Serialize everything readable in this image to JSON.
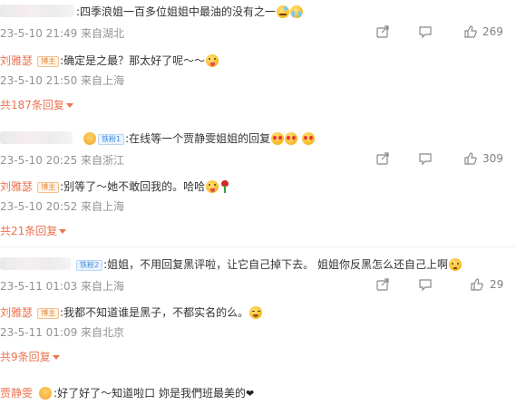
{
  "comments": [
    {
      "text": ":四季浪姐一百多位姐姐中最油的没有之一",
      "meta": "23-5-10 21:49 来自湖北",
      "like_count": "269",
      "reply": {
        "author": "刘雅瑟",
        "badge": "博主",
        "text": ":确定是之最？那太好了呢～～",
        "meta": "23-5-10 21:50 来自上海"
      },
      "more_replies": "共187条回复"
    },
    {
      "fan_badge": "铁粉1",
      "text": ":在线等一个贾静雯姐姐的回复",
      "meta": "23-5-10 20:25 来自浙江",
      "like_count": "309",
      "reply": {
        "author": "刘雅瑟",
        "badge": "博主",
        "text": ":别等了～她不敢回我的。哈哈",
        "meta": "23-5-10 20:52 来自上海"
      },
      "more_replies": "共21条回复"
    },
    {
      "fan_badge": "铁粉2",
      "text": ":姐姐，不用回复黑评啦，让它自己掉下去。 姐姐你反黑怎么还自己上啊",
      "meta": "23-5-11 01:03 来自上海",
      "like_count": "29",
      "reply": {
        "author": "刘雅瑟",
        "badge": "博主",
        "text": ":我都不知道谁是黑子，不都实名的么。",
        "meta": "23-5-11 01:09 来自北京"
      },
      "more_replies": "共9条回复"
    },
    {
      "author": "贾静雯",
      "text": ":好了好了～知道啦口 妳是我們班最美的"
    }
  ],
  "icons": {
    "share": "share-icon",
    "comment": "comment-icon",
    "like": "thumbs-up-icon"
  },
  "colors": {
    "accent": "#eb7350",
    "meta": "#939393",
    "text": "#333333"
  }
}
